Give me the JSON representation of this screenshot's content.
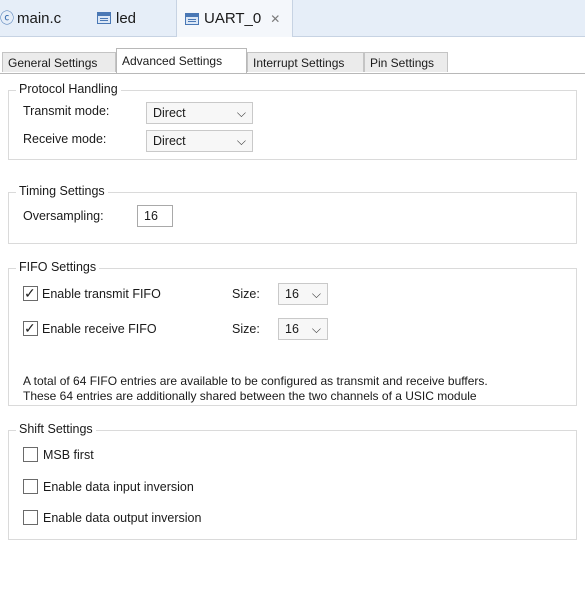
{
  "editor_tabs": [
    {
      "label": "main.c",
      "icon": "c-file-icon"
    },
    {
      "label": "led",
      "icon": "config-file-icon"
    },
    {
      "label": "UART_0",
      "icon": "config-file-icon",
      "active": true
    }
  ],
  "settings_tabs": [
    {
      "label": "General Settings"
    },
    {
      "label": "Advanced Settings",
      "active": true
    },
    {
      "label": "Interrupt Settings"
    },
    {
      "label": "Pin Settings"
    }
  ],
  "protocol": {
    "title": "Protocol Handling",
    "transmit_label": "Transmit mode:",
    "transmit_value": "Direct",
    "receive_label": "Receive mode:",
    "receive_value": "Direct"
  },
  "timing": {
    "title": "Timing Settings",
    "oversampling_label": "Oversampling:",
    "oversampling_value": "16"
  },
  "fifo": {
    "title": "FIFO Settings",
    "tx_label": "Enable transmit FIFO",
    "tx_checked": true,
    "tx_size_label": "Size:",
    "tx_size_value": "16",
    "rx_label": "Enable receive FIFO",
    "rx_checked": true,
    "rx_size_label": "Size:",
    "rx_size_value": "16",
    "note_line1": "A total of 64 FIFO entries are available to be configured as transmit and receive buffers.",
    "note_line2": "These 64 entries are additionally shared between the two channels of a USIC module"
  },
  "shift": {
    "title": "Shift Settings",
    "msb_label": "MSB first",
    "msb_checked": false,
    "input_inv_label": "Enable data input inversion",
    "input_inv_checked": false,
    "output_inv_label": "Enable data output inversion",
    "output_inv_checked": false
  }
}
